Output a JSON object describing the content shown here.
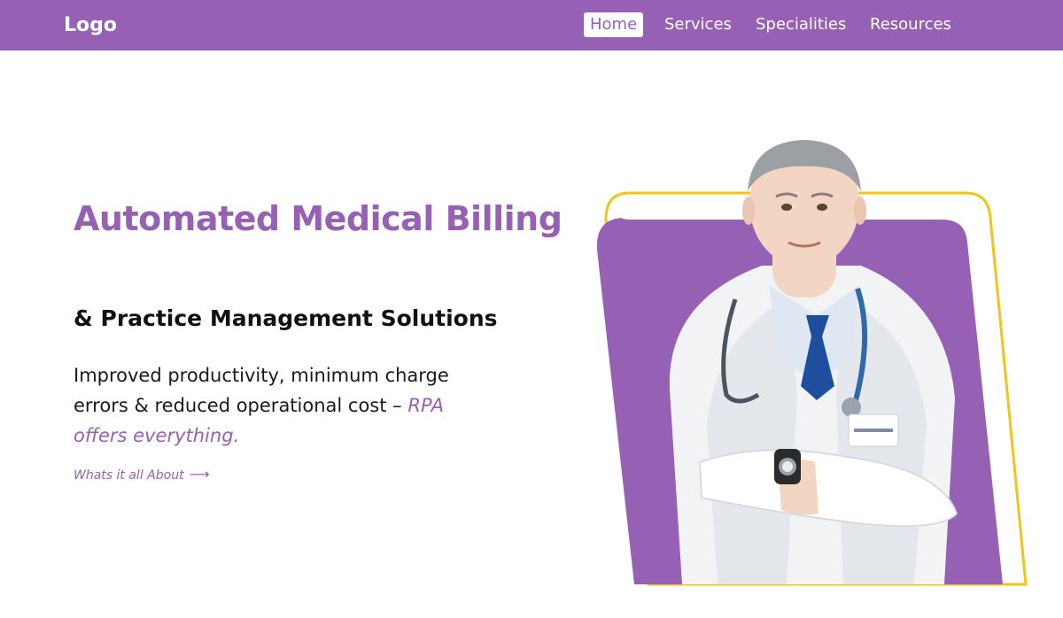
{
  "header": {
    "logo": "Logo",
    "nav": [
      {
        "label": "Home",
        "active": true
      },
      {
        "label": "Services",
        "active": false
      },
      {
        "label": "Specialities",
        "active": false
      },
      {
        "label": "Resources",
        "active": false
      }
    ]
  },
  "hero": {
    "title": "Automated Medical Billing",
    "subtitle": "& Practice Management Solutions",
    "description": "Improved productivity, minimum charge errors & reduced operational cost –",
    "description_accent": "RPA offers everything.",
    "cta_label": "Whats it all About",
    "cta_icon": "arrow-right-icon"
  },
  "colors": {
    "brand": "#9660b4",
    "accent_outline": "#f0c419",
    "background": "#ffffff",
    "text": "#111111"
  }
}
